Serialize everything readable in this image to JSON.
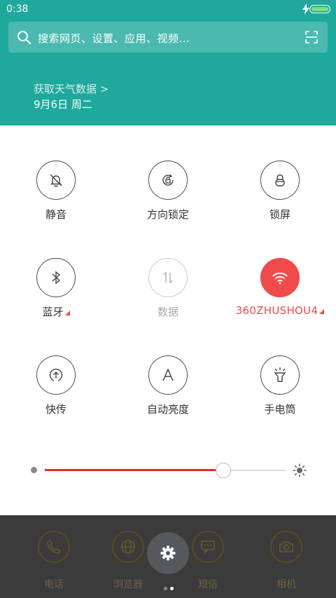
{
  "status": {
    "time": "0:38"
  },
  "search": {
    "placeholder": "搜索网页、设置、应用、视频..."
  },
  "weather": {
    "link": "获取天气数据 >",
    "date": "9月6日 周二"
  },
  "toggles": [
    {
      "label": "静音",
      "icon": "bell-off-icon",
      "state": "off"
    },
    {
      "label": "方向锁定",
      "icon": "rotation-lock-icon",
      "state": "off"
    },
    {
      "label": "锁屏",
      "icon": "lock-icon",
      "state": "off"
    },
    {
      "label": "蓝牙",
      "icon": "bluetooth-icon",
      "state": "off"
    },
    {
      "label": "数据",
      "icon": "mobile-data-icon",
      "state": "disabled"
    },
    {
      "label": "360ZHUSHOU4",
      "icon": "wifi-icon",
      "state": "active"
    },
    {
      "label": "快传",
      "icon": "transfer-icon",
      "state": "off"
    },
    {
      "label": "自动亮度",
      "icon": "auto-brightness-icon",
      "state": "off"
    },
    {
      "label": "手电筒",
      "icon": "flashlight-icon",
      "state": "off"
    }
  ],
  "brightness": {
    "level": 0.74
  },
  "dock": {
    "apps": [
      {
        "name": "电话",
        "icon": "phone-icon"
      },
      {
        "name": "浏览器",
        "icon": "globe-icon"
      },
      {
        "name": "短信",
        "icon": "message-icon"
      },
      {
        "name": "相机",
        "icon": "camera-icon"
      }
    ],
    "page_count": 2,
    "current_page": 2
  },
  "colors": {
    "header": "#1fa89c",
    "accent": "#f04a4a",
    "slider_fill": "#d9302b"
  }
}
